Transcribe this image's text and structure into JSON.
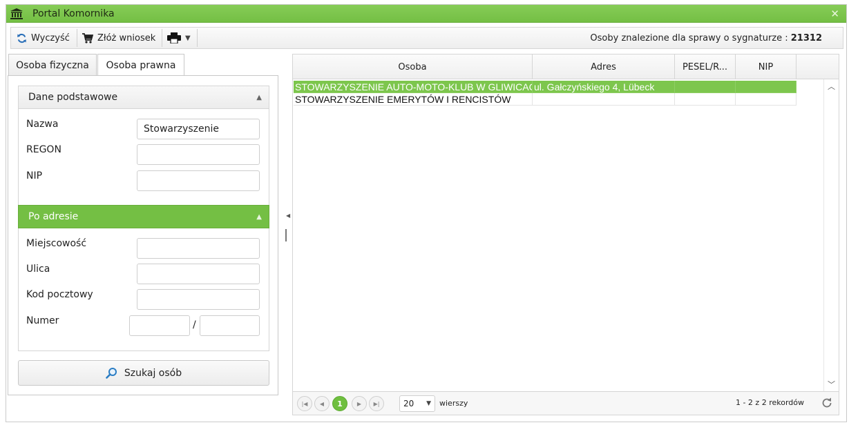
{
  "window": {
    "title": "Portal Komornika",
    "close_symbol": "✕"
  },
  "toolbar": {
    "clear_label": "Wyczyść",
    "submit_label": "Złóż wniosek",
    "info_prefix": "Osoby znalezione dla sprawy o sygnaturze :",
    "case_number": "21312"
  },
  "tabs": [
    {
      "label": "Osoba fizyczna",
      "active": false
    },
    {
      "label": "Osoba prawna",
      "active": true
    }
  ],
  "basic_section": {
    "title": "Dane podstawowe",
    "name_label": "Nazwa",
    "name_value": "Stowarzyszenie",
    "regon_label": "REGON",
    "regon_value": "",
    "nip_label": "NIP",
    "nip_value": ""
  },
  "address_section": {
    "title": "Po adresie",
    "city_label": "Miejscowość",
    "street_label": "Ulica",
    "postal_label": "Kod pocztowy",
    "number_label": "Numer",
    "number_separator": "/"
  },
  "search_button_label": "Szukaj osób",
  "grid": {
    "columns": [
      "Osoba",
      "Adres",
      "PESEL/R...",
      "NIP"
    ],
    "rows": [
      {
        "osoba": "STOWARZYSZENIE AUTO-MOTO-KLUB W GLIWICACH",
        "adres": "ul. Gałczyńskiego 4, Lübeck",
        "pesel": "",
        "nip": "",
        "selected": true
      },
      {
        "osoba": "STOWARZYSZENIE EMERYTÓW I RENCISTÓW",
        "adres": "",
        "pesel": "",
        "nip": "",
        "selected": false
      }
    ]
  },
  "pager": {
    "current_page": "1",
    "page_size": "20",
    "rows_label": "wierszy",
    "info": "1 - 2 z 2 rekordów"
  },
  "colors": {
    "accent_green": "#74bf44",
    "selected_row": "#7dc64d"
  },
  "icons": [
    "bank-icon",
    "refresh-icon",
    "cart-icon",
    "printer-icon",
    "search-icon",
    "reload-icon"
  ]
}
